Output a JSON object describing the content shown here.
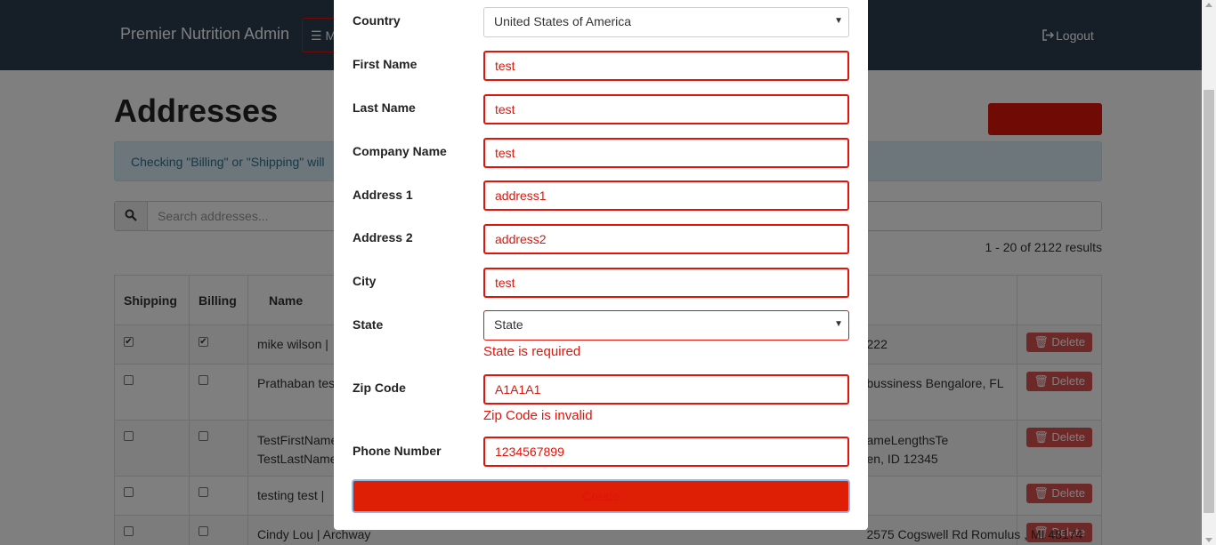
{
  "navbar": {
    "brand": "Premier Nutrition Admin",
    "menu_label": "☰ M",
    "logout_label": "Logout"
  },
  "page": {
    "title": "Addresses",
    "info_text": "Checking \"Billing\" or \"Shipping\" will",
    "search_placeholder": "Search addresses...",
    "results_text": "1 - 20 of 2122 results"
  },
  "table": {
    "headers": [
      "Shipping",
      "Billing",
      "Name",
      ""
    ],
    "rows": [
      {
        "shipping": true,
        "billing": true,
        "name": "mike wilson |",
        "address": "222",
        "delete": "Delete"
      },
      {
        "shipping": false,
        "billing": false,
        "name": "Prathaban tes",
        "address": "bussiness Bengalore, FL",
        "delete": "Delete"
      },
      {
        "shipping": false,
        "billing": false,
        "name": "TestFirstName",
        "name2": "TestLastName",
        "address": "ameLengthsTe",
        "address2": "en, ID 12345",
        "delete": "Delete"
      },
      {
        "shipping": false,
        "billing": false,
        "name": "testing test |",
        "address": "",
        "delete": "Delete"
      },
      {
        "shipping": false,
        "billing": false,
        "name": "Cindy Lou | Archway",
        "address": "2575 Cogswell Rd Romulus , MI 48174",
        "delete": "Delete"
      }
    ]
  },
  "form": {
    "country": {
      "label": "Country",
      "value": "United States of America"
    },
    "first_name": {
      "label": "First Name",
      "value": "test"
    },
    "last_name": {
      "label": "Last Name",
      "value": "test"
    },
    "company_name": {
      "label": "Company Name",
      "value": "test"
    },
    "address1": {
      "label": "Address 1",
      "value": "address1"
    },
    "address2": {
      "label": "Address 2",
      "value": "address2"
    },
    "city": {
      "label": "City",
      "value": "test"
    },
    "state": {
      "label": "State",
      "value": "State",
      "error": "State is required"
    },
    "zip": {
      "label": "Zip Code",
      "value": "A1A1A1",
      "error": "Zip Code is invalid"
    },
    "phone": {
      "label": "Phone Number",
      "value": "1234567899"
    },
    "submit_label": "Create"
  },
  "colors": {
    "navbar": "#2c3e50",
    "error": "#e0140b",
    "submit": "#de1e05"
  },
  "icons": {
    "search": "search-icon",
    "delete": "trash-icon",
    "logout": "logout-icon",
    "menu": "hamburger-icon",
    "select": "caret-down-icon"
  }
}
